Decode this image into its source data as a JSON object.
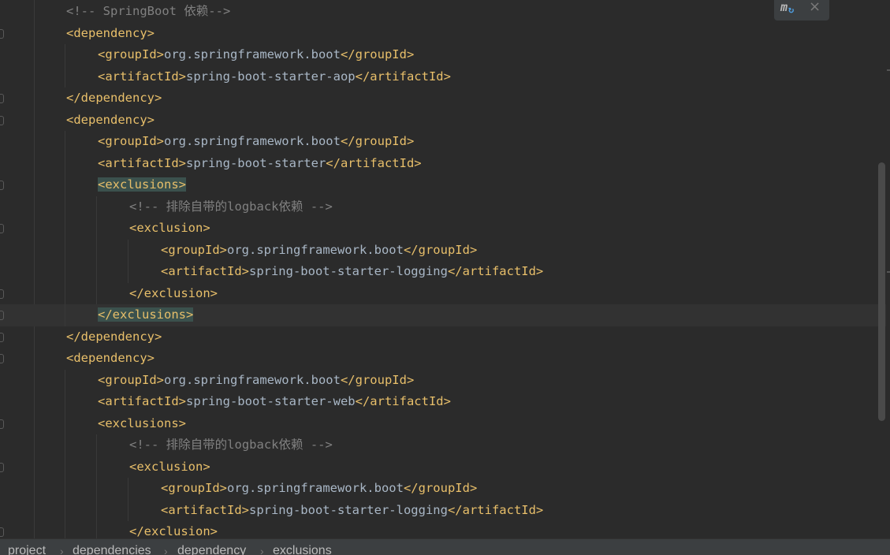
{
  "editor": {
    "lines": [
      {
        "indent": 0,
        "parts": [
          {
            "c": "comment",
            "t": "<!-- SpringBoot 依赖-->"
          }
        ]
      },
      {
        "indent": 0,
        "parts": [
          {
            "c": "tag",
            "t": "<dependency>"
          }
        ]
      },
      {
        "indent": 1,
        "parts": [
          {
            "c": "tag",
            "t": "<groupId>"
          },
          {
            "c": "text",
            "t": "org.springframework.boot"
          },
          {
            "c": "tag",
            "t": "</groupId>"
          }
        ]
      },
      {
        "indent": 1,
        "parts": [
          {
            "c": "tag",
            "t": "<artifactId>"
          },
          {
            "c": "text",
            "t": "spring-boot-starter-aop"
          },
          {
            "c": "tag",
            "t": "</artifactId>"
          }
        ]
      },
      {
        "indent": 0,
        "parts": [
          {
            "c": "tag",
            "t": "</dependency>"
          }
        ]
      },
      {
        "indent": 0,
        "parts": [
          {
            "c": "tag",
            "t": "<dependency>"
          }
        ]
      },
      {
        "indent": 1,
        "parts": [
          {
            "c": "tag",
            "t": "<groupId>"
          },
          {
            "c": "text",
            "t": "org.springframework.boot"
          },
          {
            "c": "tag",
            "t": "</groupId>"
          }
        ]
      },
      {
        "indent": 1,
        "parts": [
          {
            "c": "tag",
            "t": "<artifactId>"
          },
          {
            "c": "text",
            "t": "spring-boot-starter"
          },
          {
            "c": "tag",
            "t": "</artifactId>"
          }
        ]
      },
      {
        "indent": 1,
        "parts": [
          {
            "c": "tag hl",
            "t": "<exclusions>"
          }
        ]
      },
      {
        "indent": 2,
        "parts": [
          {
            "c": "comment",
            "t": "<!-- 排除自带的logback依赖 -->"
          }
        ]
      },
      {
        "indent": 2,
        "parts": [
          {
            "c": "tag",
            "t": "<exclusion>"
          }
        ]
      },
      {
        "indent": 3,
        "parts": [
          {
            "c": "tag",
            "t": "<groupId>"
          },
          {
            "c": "text",
            "t": "org.springframework.boot"
          },
          {
            "c": "tag",
            "t": "</groupId>"
          }
        ]
      },
      {
        "indent": 3,
        "parts": [
          {
            "c": "tag",
            "t": "<artifactId>"
          },
          {
            "c": "text",
            "t": "spring-boot-starter-logging"
          },
          {
            "c": "tag",
            "t": "</artifactId>"
          }
        ]
      },
      {
        "indent": 2,
        "parts": [
          {
            "c": "tag",
            "t": "</exclusion>"
          }
        ]
      },
      {
        "indent": 1,
        "current": true,
        "parts": [
          {
            "c": "tag hl",
            "t": "</exclusions>"
          }
        ]
      },
      {
        "indent": 0,
        "parts": [
          {
            "c": "tag",
            "t": "</dependency>"
          }
        ]
      },
      {
        "indent": 0,
        "parts": [
          {
            "c": "tag",
            "t": "<dependency>"
          }
        ]
      },
      {
        "indent": 1,
        "parts": [
          {
            "c": "tag",
            "t": "<groupId>"
          },
          {
            "c": "text",
            "t": "org.springframework.boot"
          },
          {
            "c": "tag",
            "t": "</groupId>"
          }
        ]
      },
      {
        "indent": 1,
        "parts": [
          {
            "c": "tag",
            "t": "<artifactId>"
          },
          {
            "c": "text",
            "t": "spring-boot-starter-web"
          },
          {
            "c": "tag",
            "t": "</artifactId>"
          }
        ]
      },
      {
        "indent": 1,
        "parts": [
          {
            "c": "tag",
            "t": "<exclusions>"
          }
        ]
      },
      {
        "indent": 2,
        "parts": [
          {
            "c": "comment",
            "t": "<!-- 排除自带的logback依赖 -->"
          }
        ]
      },
      {
        "indent": 2,
        "parts": [
          {
            "c": "tag",
            "t": "<exclusion>"
          }
        ]
      },
      {
        "indent": 3,
        "parts": [
          {
            "c": "tag",
            "t": "<groupId>"
          },
          {
            "c": "text",
            "t": "org.springframework.boot"
          },
          {
            "c": "tag",
            "t": "</groupId>"
          }
        ]
      },
      {
        "indent": 3,
        "parts": [
          {
            "c": "tag",
            "t": "<artifactId>"
          },
          {
            "c": "text",
            "t": "spring-boot-starter-logging"
          },
          {
            "c": "tag",
            "t": "</artifactId>"
          }
        ]
      },
      {
        "indent": 2,
        "parts": [
          {
            "c": "tag",
            "t": "</exclusion>"
          }
        ]
      }
    ]
  },
  "toolbar": {
    "maven_icon": "maven-reload-icon",
    "close_icon": "close-icon",
    "close_glyph": "×",
    "maven_glyph": "m"
  },
  "breadcrumb": {
    "items": [
      "project",
      "dependencies",
      "dependency",
      "exclusions"
    ],
    "separator": "›"
  },
  "colors": {
    "background": "#2b2b2b",
    "tag": "#e8bf6a",
    "text": "#a9b7c6",
    "comment": "#808080",
    "highlight": "#3b514d"
  }
}
